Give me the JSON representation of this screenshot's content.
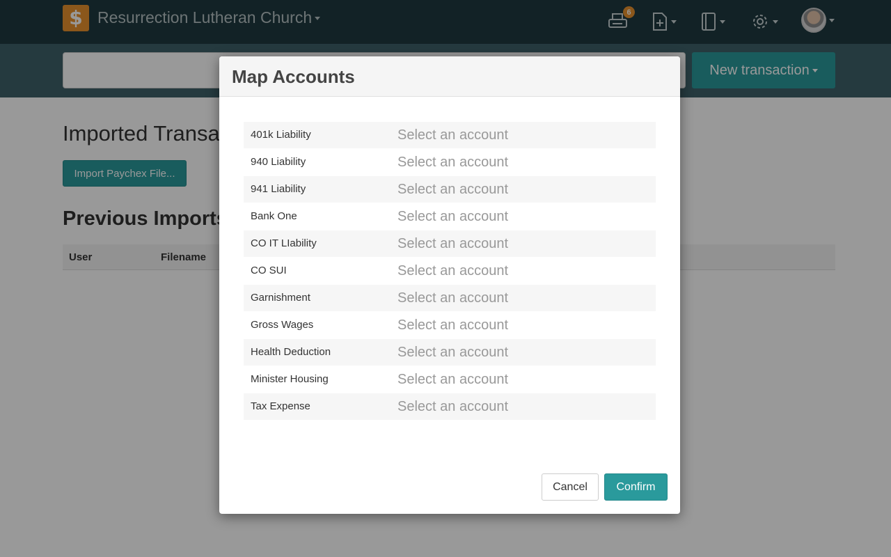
{
  "navbar": {
    "brand_symbol": "$",
    "org_name": "Resurrection Lutheran Church",
    "print_badge_count": "6",
    "icons": [
      "dollar-logo-icon",
      "printer-icon",
      "new-document-icon",
      "ledger-book-icon",
      "gear-icon",
      "user-avatar"
    ]
  },
  "subbar": {
    "search_value": "",
    "new_transaction_label": "New transaction"
  },
  "page": {
    "title": "Imported Transactions",
    "import_button_label": "Import Paychex File...",
    "previous_imports_title": "Previous Imports",
    "columns": [
      "User",
      "Filename"
    ]
  },
  "modal": {
    "title": "Map Accounts",
    "rows": [
      {
        "label": "401k Liability",
        "select": "Select an account"
      },
      {
        "label": "940 Liability",
        "select": "Select an account"
      },
      {
        "label": "941 Liability",
        "select": "Select an account"
      },
      {
        "label": "Bank One",
        "select": "Select an account"
      },
      {
        "label": "CO IT LIability",
        "select": "Select an account"
      },
      {
        "label": "CO SUI",
        "select": "Select an account"
      },
      {
        "label": "Garnishment",
        "select": "Select an account"
      },
      {
        "label": "Gross Wages",
        "select": "Select an account"
      },
      {
        "label": "Health Deduction",
        "select": "Select an account"
      },
      {
        "label": "Minister Housing",
        "select": "Select an account"
      },
      {
        "label": "Tax Expense",
        "select": "Select an account"
      }
    ],
    "cancel_label": "Cancel",
    "confirm_label": "Confirm"
  },
  "colors": {
    "navbar": "#1e3a40",
    "subbar": "#3f6269",
    "accent": "#2a9a9c",
    "brand": "#e8912d"
  }
}
